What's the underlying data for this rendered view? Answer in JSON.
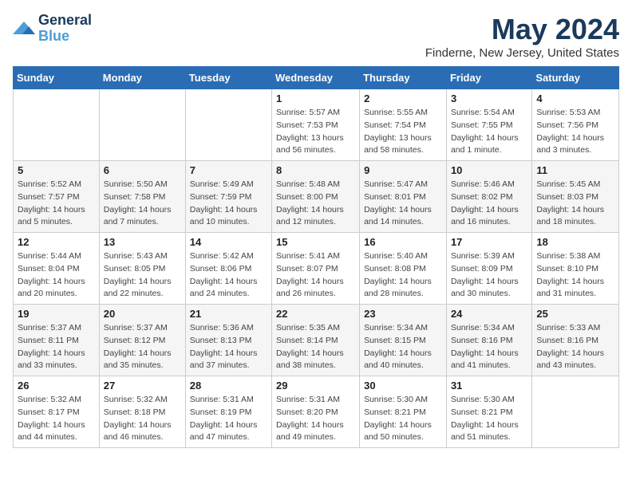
{
  "logo": {
    "line1": "General",
    "line2": "Blue"
  },
  "title": "May 2024",
  "subtitle": "Finderne, New Jersey, United States",
  "days_header": [
    "Sunday",
    "Monday",
    "Tuesday",
    "Wednesday",
    "Thursday",
    "Friday",
    "Saturday"
  ],
  "weeks": [
    [
      {
        "day": "",
        "sunrise": "",
        "sunset": "",
        "daylight": ""
      },
      {
        "day": "",
        "sunrise": "",
        "sunset": "",
        "daylight": ""
      },
      {
        "day": "",
        "sunrise": "",
        "sunset": "",
        "daylight": ""
      },
      {
        "day": "1",
        "sunrise": "Sunrise: 5:57 AM",
        "sunset": "Sunset: 7:53 PM",
        "daylight": "Daylight: 13 hours and 56 minutes."
      },
      {
        "day": "2",
        "sunrise": "Sunrise: 5:55 AM",
        "sunset": "Sunset: 7:54 PM",
        "daylight": "Daylight: 13 hours and 58 minutes."
      },
      {
        "day": "3",
        "sunrise": "Sunrise: 5:54 AM",
        "sunset": "Sunset: 7:55 PM",
        "daylight": "Daylight: 14 hours and 1 minute."
      },
      {
        "day": "4",
        "sunrise": "Sunrise: 5:53 AM",
        "sunset": "Sunset: 7:56 PM",
        "daylight": "Daylight: 14 hours and 3 minutes."
      }
    ],
    [
      {
        "day": "5",
        "sunrise": "Sunrise: 5:52 AM",
        "sunset": "Sunset: 7:57 PM",
        "daylight": "Daylight: 14 hours and 5 minutes."
      },
      {
        "day": "6",
        "sunrise": "Sunrise: 5:50 AM",
        "sunset": "Sunset: 7:58 PM",
        "daylight": "Daylight: 14 hours and 7 minutes."
      },
      {
        "day": "7",
        "sunrise": "Sunrise: 5:49 AM",
        "sunset": "Sunset: 7:59 PM",
        "daylight": "Daylight: 14 hours and 10 minutes."
      },
      {
        "day": "8",
        "sunrise": "Sunrise: 5:48 AM",
        "sunset": "Sunset: 8:00 PM",
        "daylight": "Daylight: 14 hours and 12 minutes."
      },
      {
        "day": "9",
        "sunrise": "Sunrise: 5:47 AM",
        "sunset": "Sunset: 8:01 PM",
        "daylight": "Daylight: 14 hours and 14 minutes."
      },
      {
        "day": "10",
        "sunrise": "Sunrise: 5:46 AM",
        "sunset": "Sunset: 8:02 PM",
        "daylight": "Daylight: 14 hours and 16 minutes."
      },
      {
        "day": "11",
        "sunrise": "Sunrise: 5:45 AM",
        "sunset": "Sunset: 8:03 PM",
        "daylight": "Daylight: 14 hours and 18 minutes."
      }
    ],
    [
      {
        "day": "12",
        "sunrise": "Sunrise: 5:44 AM",
        "sunset": "Sunset: 8:04 PM",
        "daylight": "Daylight: 14 hours and 20 minutes."
      },
      {
        "day": "13",
        "sunrise": "Sunrise: 5:43 AM",
        "sunset": "Sunset: 8:05 PM",
        "daylight": "Daylight: 14 hours and 22 minutes."
      },
      {
        "day": "14",
        "sunrise": "Sunrise: 5:42 AM",
        "sunset": "Sunset: 8:06 PM",
        "daylight": "Daylight: 14 hours and 24 minutes."
      },
      {
        "day": "15",
        "sunrise": "Sunrise: 5:41 AM",
        "sunset": "Sunset: 8:07 PM",
        "daylight": "Daylight: 14 hours and 26 minutes."
      },
      {
        "day": "16",
        "sunrise": "Sunrise: 5:40 AM",
        "sunset": "Sunset: 8:08 PM",
        "daylight": "Daylight: 14 hours and 28 minutes."
      },
      {
        "day": "17",
        "sunrise": "Sunrise: 5:39 AM",
        "sunset": "Sunset: 8:09 PM",
        "daylight": "Daylight: 14 hours and 30 minutes."
      },
      {
        "day": "18",
        "sunrise": "Sunrise: 5:38 AM",
        "sunset": "Sunset: 8:10 PM",
        "daylight": "Daylight: 14 hours and 31 minutes."
      }
    ],
    [
      {
        "day": "19",
        "sunrise": "Sunrise: 5:37 AM",
        "sunset": "Sunset: 8:11 PM",
        "daylight": "Daylight: 14 hours and 33 minutes."
      },
      {
        "day": "20",
        "sunrise": "Sunrise: 5:37 AM",
        "sunset": "Sunset: 8:12 PM",
        "daylight": "Daylight: 14 hours and 35 minutes."
      },
      {
        "day": "21",
        "sunrise": "Sunrise: 5:36 AM",
        "sunset": "Sunset: 8:13 PM",
        "daylight": "Daylight: 14 hours and 37 minutes."
      },
      {
        "day": "22",
        "sunrise": "Sunrise: 5:35 AM",
        "sunset": "Sunset: 8:14 PM",
        "daylight": "Daylight: 14 hours and 38 minutes."
      },
      {
        "day": "23",
        "sunrise": "Sunrise: 5:34 AM",
        "sunset": "Sunset: 8:15 PM",
        "daylight": "Daylight: 14 hours and 40 minutes."
      },
      {
        "day": "24",
        "sunrise": "Sunrise: 5:34 AM",
        "sunset": "Sunset: 8:16 PM",
        "daylight": "Daylight: 14 hours and 41 minutes."
      },
      {
        "day": "25",
        "sunrise": "Sunrise: 5:33 AM",
        "sunset": "Sunset: 8:16 PM",
        "daylight": "Daylight: 14 hours and 43 minutes."
      }
    ],
    [
      {
        "day": "26",
        "sunrise": "Sunrise: 5:32 AM",
        "sunset": "Sunset: 8:17 PM",
        "daylight": "Daylight: 14 hours and 44 minutes."
      },
      {
        "day": "27",
        "sunrise": "Sunrise: 5:32 AM",
        "sunset": "Sunset: 8:18 PM",
        "daylight": "Daylight: 14 hours and 46 minutes."
      },
      {
        "day": "28",
        "sunrise": "Sunrise: 5:31 AM",
        "sunset": "Sunset: 8:19 PM",
        "daylight": "Daylight: 14 hours and 47 minutes."
      },
      {
        "day": "29",
        "sunrise": "Sunrise: 5:31 AM",
        "sunset": "Sunset: 8:20 PM",
        "daylight": "Daylight: 14 hours and 49 minutes."
      },
      {
        "day": "30",
        "sunrise": "Sunrise: 5:30 AM",
        "sunset": "Sunset: 8:21 PM",
        "daylight": "Daylight: 14 hours and 50 minutes."
      },
      {
        "day": "31",
        "sunrise": "Sunrise: 5:30 AM",
        "sunset": "Sunset: 8:21 PM",
        "daylight": "Daylight: 14 hours and 51 minutes."
      },
      {
        "day": "",
        "sunrise": "",
        "sunset": "",
        "daylight": ""
      }
    ]
  ]
}
